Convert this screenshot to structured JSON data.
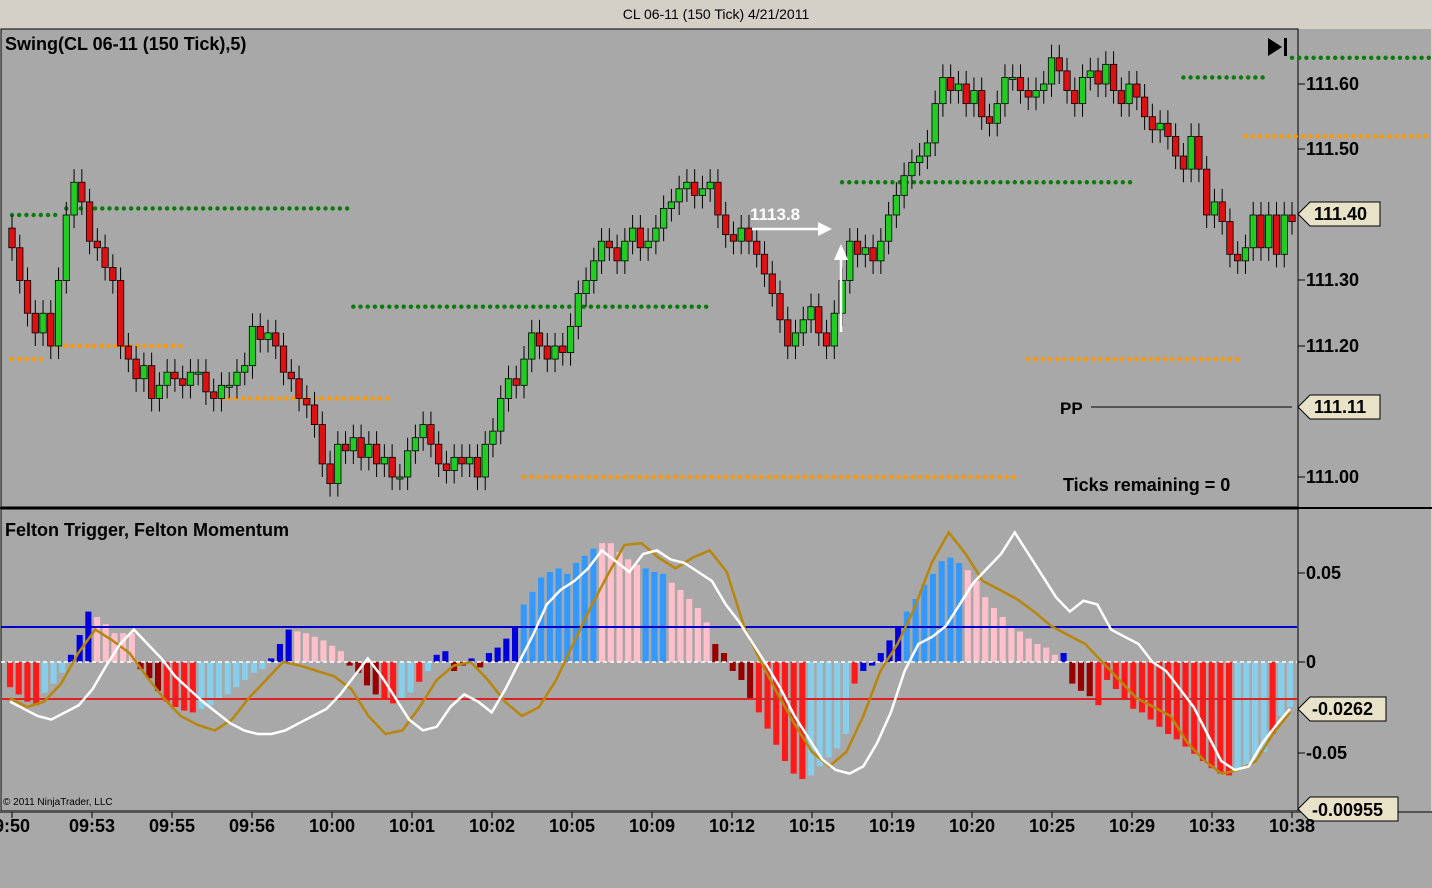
{
  "window": {
    "title": "CL 06-11 (150 Tick)  4/21/2011"
  },
  "price_panel": {
    "title": "Swing(CL 06-11 (150 Tick),5)",
    "annotation_value": "1113.8",
    "pivot_label": "PP",
    "ticks_remaining": "Ticks remaining = 0",
    "y_ticks": [
      "111.60",
      "111.50",
      "111.40",
      "111.30",
      "111.20",
      "111.00"
    ],
    "last_price_marker": "111.40",
    "pp_marker": "111.11"
  },
  "indicator_panel": {
    "title": "Felton Trigger, Felton Momentum",
    "y_ticks": [
      "0.05",
      "0",
      "-0.05"
    ],
    "markers": [
      "-0.0262",
      "-0.00955"
    ],
    "copyright": "© 2011 NinjaTrader, LLC"
  },
  "x_axis": {
    "labels": [
      "9:50",
      "09:53",
      "09:55",
      "09:56",
      "10:00",
      "10:01",
      "10:02",
      "10:05",
      "10:09",
      "10:12",
      "10:15",
      "10:19",
      "10:20",
      "10:25",
      "10:29",
      "10:33",
      "10:38"
    ]
  },
  "colors": {
    "background": "#a8a8a8",
    "up_candle": "#22cc22",
    "down_candle": "#dd1111",
    "swing_high": "#0a7a0a",
    "swing_low": "#ff9900",
    "trigger_line": "#ffffff",
    "momentum_line": "#b8860b",
    "upper_level": "#0000cc",
    "lower_level": "#dd2222"
  },
  "chart_data": [
    {
      "type": "candlestick",
      "title": "Swing(CL 06-11 (150 Tick),5)",
      "ylim": [
        110.95,
        111.68
      ],
      "close": [
        111.35,
        111.3,
        111.25,
        111.22,
        111.25,
        111.2,
        111.3,
        111.4,
        111.45,
        111.42,
        111.36,
        111.35,
        111.32,
        111.3,
        111.2,
        111.18,
        111.15,
        111.17,
        111.12,
        111.14,
        111.16,
        111.15,
        111.14,
        111.16,
        111.16,
        111.13,
        111.12,
        111.14,
        111.14,
        111.16,
        111.17,
        111.23,
        111.21,
        111.22,
        111.2,
        111.16,
        111.15,
        111.12,
        111.11,
        111.08,
        111.02,
        110.99,
        111.05,
        111.04,
        111.06,
        111.03,
        111.05,
        111.02,
        111.03,
        111.0,
        111.0,
        111.04,
        111.06,
        111.08,
        111.05,
        111.02,
        111.01,
        111.03,
        111.02,
        111.03,
        111.0,
        111.05,
        111.07,
        111.12,
        111.15,
        111.14,
        111.18,
        111.22,
        111.2,
        111.18,
        111.2,
        111.19,
        111.23,
        111.28,
        111.3,
        111.33,
        111.36,
        111.35,
        111.33,
        111.36,
        111.38,
        111.35,
        111.36,
        111.38,
        111.41,
        111.42,
        111.44,
        111.45,
        111.43,
        111.44,
        111.45,
        111.4,
        111.37,
        111.36,
        111.38,
        111.36,
        111.34,
        111.31,
        111.28,
        111.24,
        111.2,
        111.22,
        111.24,
        111.26,
        111.22,
        111.2,
        111.25,
        111.3,
        111.36,
        111.34,
        111.35,
        111.33,
        111.36,
        111.4,
        111.43,
        111.46,
        111.48,
        111.49,
        111.51,
        111.57,
        111.61,
        111.59,
        111.6,
        111.57,
        111.59,
        111.55,
        111.54,
        111.57,
        111.61,
        111.61,
        111.59,
        111.58,
        111.59,
        111.6,
        111.64,
        111.62,
        111.59,
        111.57,
        111.61,
        111.62,
        111.6,
        111.63,
        111.59,
        111.57,
        111.6,
        111.58,
        111.55,
        111.53,
        111.54,
        111.52,
        111.49,
        111.47,
        111.52,
        111.47,
        111.4,
        111.42,
        111.39,
        111.34,
        111.33,
        111.35,
        111.4,
        111.35,
        111.4,
        111.34,
        111.4,
        111.39
      ]
    },
    {
      "type": "bar+line",
      "title": "Felton Trigger, Felton Momentum",
      "ylim": [
        -0.072,
        0.072
      ],
      "upper_level": 0.02,
      "lower_level": -0.0262,
      "histogram": [
        -0.014,
        -0.018,
        -0.022,
        -0.024,
        -0.017,
        -0.012,
        -0.006,
        0.004,
        0.015,
        0.028,
        0.025,
        0.021,
        0.016,
        0.016,
        0.016,
        -0.004,
        -0.009,
        -0.016,
        -0.022,
        -0.025,
        -0.027,
        -0.028,
        -0.026,
        -0.024,
        -0.021,
        -0.018,
        -0.014,
        -0.01,
        -0.006,
        -0.004,
        0.002,
        0.01,
        0.018,
        0.017,
        0.016,
        0.014,
        0.012,
        0.009,
        0.006,
        -0.002,
        -0.006,
        -0.013,
        -0.018,
        -0.021,
        -0.023,
        -0.02,
        -0.017,
        -0.011,
        -0.005,
        0.004,
        0.006,
        -0.005,
        -0.002,
        0.002,
        -0.003,
        0.005,
        0.008,
        0.013,
        0.02,
        0.032,
        0.039,
        0.047,
        0.05,
        0.052,
        0.049,
        0.055,
        0.059,
        0.063,
        0.066,
        0.066,
        0.061,
        0.057,
        0.054,
        0.052,
        0.05,
        0.049,
        0.044,
        0.04,
        0.035,
        0.03,
        0.022,
        0.01,
        0.005,
        -0.005,
        -0.01,
        -0.02,
        -0.028,
        -0.037,
        -0.046,
        -0.055,
        -0.062,
        -0.065,
        -0.063,
        -0.058,
        -0.053,
        -0.048,
        -0.04,
        -0.012,
        -0.005,
        -0.002,
        0.005,
        0.012,
        0.02,
        0.028,
        0.035,
        0.043,
        0.049,
        0.056,
        0.058,
        0.055,
        0.051,
        0.045,
        0.036,
        0.03,
        0.025,
        0.02,
        0.017,
        0.013,
        0.01,
        0.008,
        0.004,
        0.005,
        -0.012,
        -0.016,
        -0.019,
        -0.024,
        -0.01,
        -0.015,
        -0.02,
        -0.026,
        -0.028,
        -0.032,
        -0.036,
        -0.04,
        -0.043,
        -0.047,
        -0.051,
        -0.055,
        -0.059,
        -0.062,
        -0.063,
        -0.061,
        -0.058,
        -0.055,
        -0.05,
        -0.04,
        -0.03,
        -0.025
      ],
      "histogram_colors": [
        "r",
        "r",
        "r",
        "r",
        "lb",
        "lb",
        "lb",
        "b",
        "b",
        "b",
        "pk",
        "pk",
        "pk",
        "pk",
        "pk",
        "dr",
        "dr",
        "dr",
        "r",
        "r",
        "r",
        "r",
        "lb",
        "lb",
        "lb",
        "lb",
        "lb",
        "lb",
        "lb",
        "lb",
        "b",
        "b",
        "b",
        "pk",
        "pk",
        "pk",
        "pk",
        "pk",
        "pk",
        "dr",
        "dr",
        "dr",
        "dr",
        "r",
        "r",
        "lb",
        "lb",
        "r",
        "lb",
        "b",
        "b",
        "dr",
        "dr",
        "b",
        "dr",
        "b",
        "b",
        "b",
        "b",
        "mb",
        "mb",
        "mb",
        "mb",
        "mb",
        "mb",
        "mb",
        "mb",
        "mb",
        "pk",
        "pk",
        "pk",
        "pk",
        "pk",
        "mb",
        "mb",
        "mb",
        "pk",
        "pk",
        "pk",
        "pk",
        "pk",
        "dr",
        "dr",
        "dr",
        "dr",
        "dr",
        "r",
        "r",
        "r",
        "r",
        "r",
        "r",
        "lb",
        "lb",
        "lb",
        "lb",
        "lb",
        "r",
        "b",
        "b",
        "b",
        "b",
        "b",
        "mb",
        "mb",
        "mb",
        "mb",
        "mb",
        "mb",
        "mb",
        "pk",
        "pk",
        "pk",
        "pk",
        "pk",
        "pk",
        "pk",
        "pk",
        "pk",
        "pk",
        "pk",
        "b",
        "dr",
        "dr",
        "dr",
        "r",
        "r",
        "r",
        "r",
        "r",
        "r",
        "r",
        "r",
        "r",
        "r",
        "r",
        "r",
        "r",
        "r",
        "r",
        "r",
        "lb",
        "lb",
        "lb",
        "lb",
        "r",
        "lb",
        "lb"
      ],
      "trigger": [
        -0.022,
        -0.026,
        -0.03,
        -0.032,
        -0.028,
        -0.024,
        -0.015,
        -0.002,
        0.01,
        0.018,
        0.01,
        0.002,
        -0.008,
        -0.015,
        -0.022,
        -0.028,
        -0.034,
        -0.038,
        -0.04,
        -0.04,
        -0.038,
        -0.034,
        -0.03,
        -0.026,
        -0.018,
        -0.008,
        0.002,
        -0.008,
        -0.02,
        -0.032,
        -0.038,
        -0.036,
        -0.025,
        -0.018,
        -0.022,
        -0.028,
        -0.015,
        0.0,
        0.015,
        0.032,
        0.04,
        0.045,
        0.052,
        0.062,
        0.056,
        0.05,
        0.06,
        0.062,
        0.057,
        0.055,
        0.05,
        0.045,
        0.032,
        0.022,
        0.01,
        -0.002,
        -0.015,
        -0.03,
        -0.042,
        -0.054,
        -0.06,
        -0.062,
        -0.058,
        -0.045,
        -0.028,
        -0.005,
        0.01,
        0.014,
        0.02,
        0.032,
        0.044,
        0.052,
        0.06,
        0.072,
        0.06,
        0.048,
        0.036,
        0.028,
        0.034,
        0.032,
        0.018,
        0.014,
        0.01,
        0.0,
        -0.005,
        -0.015,
        -0.025,
        -0.04,
        -0.055,
        -0.06,
        -0.058,
        -0.045,
        -0.035,
        -0.026
      ],
      "momentum": [
        -0.02,
        -0.025,
        -0.022,
        -0.012,
        0.005,
        0.018,
        0.012,
        0.005,
        -0.008,
        -0.02,
        -0.03,
        -0.035,
        -0.038,
        -0.032,
        -0.02,
        -0.01,
        0.0,
        -0.002,
        -0.005,
        -0.008,
        -0.015,
        -0.03,
        -0.04,
        -0.038,
        -0.025,
        -0.01,
        -0.002,
        0.0,
        -0.01,
        -0.022,
        -0.03,
        -0.025,
        -0.01,
        0.01,
        0.03,
        0.048,
        0.065,
        0.066,
        0.058,
        0.052,
        0.058,
        0.062,
        0.05,
        0.02,
        0.0,
        -0.018,
        -0.035,
        -0.05,
        -0.058,
        -0.05,
        -0.03,
        -0.005,
        0.01,
        0.03,
        0.055,
        0.072,
        0.06,
        0.045,
        0.04,
        0.035,
        0.028,
        0.02,
        0.015,
        0.01,
        0.0,
        -0.01,
        -0.02,
        -0.025,
        -0.03,
        -0.045,
        -0.055,
        -0.062,
        -0.06,
        -0.055,
        -0.04,
        -0.028
      ]
    }
  ]
}
